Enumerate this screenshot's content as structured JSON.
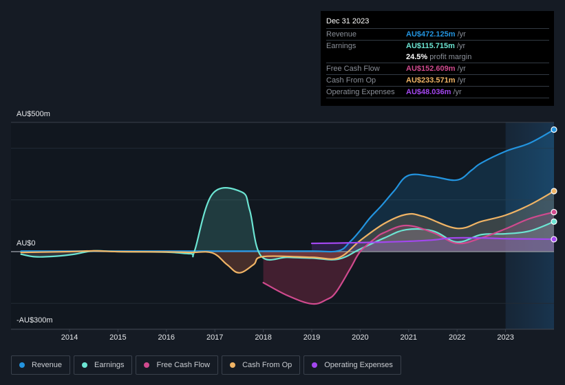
{
  "tooltip": {
    "date": "Dec 31 2023",
    "rows": [
      {
        "label": "Revenue",
        "value": "AU$472.125m",
        "unit": "/yr",
        "color": "#2394df"
      },
      {
        "label": "Earnings",
        "value": "AU$115.715m",
        "unit": "/yr",
        "color": "#6ce5d3"
      },
      {
        "label": "",
        "value": "24.5%",
        "unit": "profit margin",
        "color": "#ffffff"
      },
      {
        "label": "Free Cash Flow",
        "value": "AU$152.609m",
        "unit": "/yr",
        "color": "#d04a8e"
      },
      {
        "label": "Cash From Op",
        "value": "AU$233.571m",
        "unit": "/yr",
        "color": "#f0b465"
      },
      {
        "label": "Operating Expenses",
        "value": "AU$48.036m",
        "unit": "/yr",
        "color": "#a347f0"
      }
    ]
  },
  "legend": [
    {
      "label": "Revenue",
      "color": "#2394df"
    },
    {
      "label": "Earnings",
      "color": "#6ce5d3"
    },
    {
      "label": "Free Cash Flow",
      "color": "#d04a8e"
    },
    {
      "label": "Cash From Op",
      "color": "#f0b465"
    },
    {
      "label": "Operating Expenses",
      "color": "#a347f0"
    }
  ],
  "chart_data": {
    "type": "line",
    "title": "",
    "xlabel": "",
    "ylabel": "",
    "y_tick_labels": [
      "AU$500m",
      "AU$0",
      "-AU$300m"
    ],
    "x_tick_labels": [
      "2014",
      "2015",
      "2016",
      "2017",
      "2018",
      "2019",
      "2020",
      "2021",
      "2022",
      "2023"
    ],
    "x_ticks": [
      2014,
      2015,
      2016,
      2017,
      2018,
      2019,
      2020,
      2021,
      2022,
      2023
    ],
    "xlim": [
      2012.79,
      2024.0
    ],
    "ylim": [
      -300,
      500
    ],
    "gridlines_y": [
      500,
      400,
      200,
      0,
      -200,
      -300
    ],
    "grid": true,
    "forecast_region_start": 2023.0,
    "legend_position": "bottom",
    "units": "AU$ millions",
    "series": [
      {
        "name": "Revenue",
        "color": "#2394df",
        "x": [
          2013.0,
          2014.0,
          2015.0,
          2016.0,
          2017.0,
          2018.0,
          2019.0,
          2019.55,
          2019.8,
          2020.0,
          2020.2,
          2020.45,
          2020.7,
          2021.0,
          2021.5,
          2022.0,
          2022.3,
          2022.5,
          2023.0,
          2023.5,
          2024.0
        ],
        "values": [
          2,
          2,
          2,
          2,
          2,
          2,
          2,
          3,
          40,
          82,
          130,
          180,
          235,
          295,
          290,
          277,
          315,
          343,
          388,
          420,
          472
        ]
      },
      {
        "name": "Earnings",
        "color": "#6ce5d3",
        "x": [
          2013.0,
          2013.3,
          2013.7,
          2014.1,
          2014.5,
          2015.0,
          2016.0,
          2016.5,
          2016.58,
          2016.95,
          2017.55,
          2017.72,
          2017.95,
          2018.5,
          2019.0,
          2019.55,
          2020.0,
          2020.5,
          2020.95,
          2021.5,
          2022.0,
          2022.5,
          2023.0,
          2023.5,
          2024.0
        ],
        "values": [
          -10,
          -20,
          -18,
          -10,
          3,
          0,
          -2,
          -8,
          2,
          223,
          231,
          160,
          -16,
          -22,
          -25,
          -29,
          10,
          53,
          85,
          80,
          37,
          66,
          69,
          80,
          116
        ]
      },
      {
        "name": "Free Cash Flow",
        "color": "#d04a8e",
        "x": [
          2018.0,
          2018.5,
          2019.0,
          2019.3,
          2019.5,
          2019.8,
          2020.0,
          2020.3,
          2020.5,
          2020.95,
          2021.5,
          2022.0,
          2022.5,
          2023.0,
          2023.5,
          2024.0
        ],
        "values": [
          -120,
          -170,
          -202,
          -186,
          -157,
          -64,
          0,
          50,
          74,
          101,
          74,
          32,
          53,
          88,
          128,
          153
        ]
      },
      {
        "name": "Cash From Op",
        "color": "#f0b465",
        "x": [
          2013.0,
          2014.0,
          2014.5,
          2015.0,
          2016.0,
          2016.5,
          2016.95,
          2017.25,
          2017.5,
          2017.8,
          2018.0,
          2019.0,
          2019.55,
          2020.0,
          2020.5,
          2020.95,
          2021.3,
          2022.0,
          2022.5,
          2023.0,
          2023.5,
          2024.0
        ],
        "values": [
          -3,
          0,
          3,
          0,
          -1,
          -3,
          -5,
          -50,
          -82,
          -50,
          -19,
          -22,
          -24,
          43,
          109,
          144,
          136,
          90,
          117,
          141,
          181,
          234
        ]
      },
      {
        "name": "Operating Expenses",
        "color": "#a347f0",
        "x": [
          2019.0,
          2019.5,
          2020.0,
          2020.5,
          2021.0,
          2021.5,
          2021.9,
          2022.5,
          2023.0,
          2023.5,
          2024.0
        ],
        "values": [
          32,
          33,
          35,
          37,
          40,
          45,
          53,
          53,
          50,
          49,
          48
        ]
      }
    ]
  }
}
